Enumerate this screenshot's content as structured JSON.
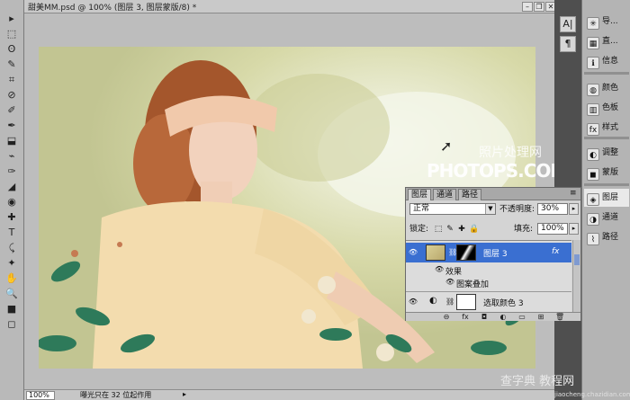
{
  "document": {
    "title": "甜美MM.psd @ 100% (图层 3, 图层蒙版/8) *",
    "window_buttons": [
      "–",
      "❐",
      "✕"
    ]
  },
  "toolbox": {
    "tools": [
      "▸",
      "⬚",
      "ʘ",
      "✎",
      "⌗",
      "⊘",
      "✐",
      "✒",
      "⬓",
      "⌁",
      "✑",
      "◢",
      "◉",
      "✚",
      "T",
      "⤹",
      "✦",
      "✋",
      "🔍",
      "■",
      "◻"
    ]
  },
  "status": {
    "zoom": "100%",
    "message": "曝光只在 32 位起作用",
    "arrow": "▸"
  },
  "dock_narrow": {
    "buttons": [
      "A|",
      "¶"
    ]
  },
  "dock_wide": {
    "items": [
      {
        "icon": "✳",
        "label": "导..."
      },
      {
        "icon": "▦",
        "label": "直..."
      },
      {
        "icon": "ℹ",
        "label": "信息"
      },
      {
        "icon": "◍",
        "label": "颜色"
      },
      {
        "icon": "▥",
        "label": "色板"
      },
      {
        "icon": "fx",
        "label": "样式"
      },
      {
        "icon": "◐",
        "label": "调整"
      },
      {
        "icon": "◼",
        "label": "蒙版"
      },
      {
        "icon": "◈",
        "label": "图层"
      },
      {
        "icon": "◑",
        "label": "通道"
      },
      {
        "icon": "⌇",
        "label": "路径"
      }
    ],
    "active_index": 8
  },
  "layers_panel": {
    "tabs": [
      "图层",
      "通道",
      "路径"
    ],
    "active_tab": 0,
    "menu_icon": "≡",
    "blend_mode": "正常",
    "opacity_label": "不透明度:",
    "opacity_value": "30%",
    "lock_label": "锁定:",
    "lock_icons": [
      "⬚",
      "✎",
      "✚",
      "🔒"
    ],
    "fill_label": "填充:",
    "fill_value": "100%",
    "layers": [
      {
        "name": "图层 3",
        "fx": "fx",
        "selected": true
      },
      {
        "name": "效果",
        "selected": false
      },
      {
        "name": "图案叠加",
        "selected": false
      },
      {
        "name": "选取颜色 3",
        "selected": false
      }
    ],
    "footer_icons": [
      "⊖",
      "fx",
      "◘",
      "◐",
      "▭",
      "⊞",
      "🗑"
    ]
  },
  "watermark": {
    "chinese": "照片处理网",
    "english": "PHOTOPS.COM",
    "bottom_chinese": "查字典 教程网",
    "bottom_url": "jiaocheng.chazidian.com"
  }
}
